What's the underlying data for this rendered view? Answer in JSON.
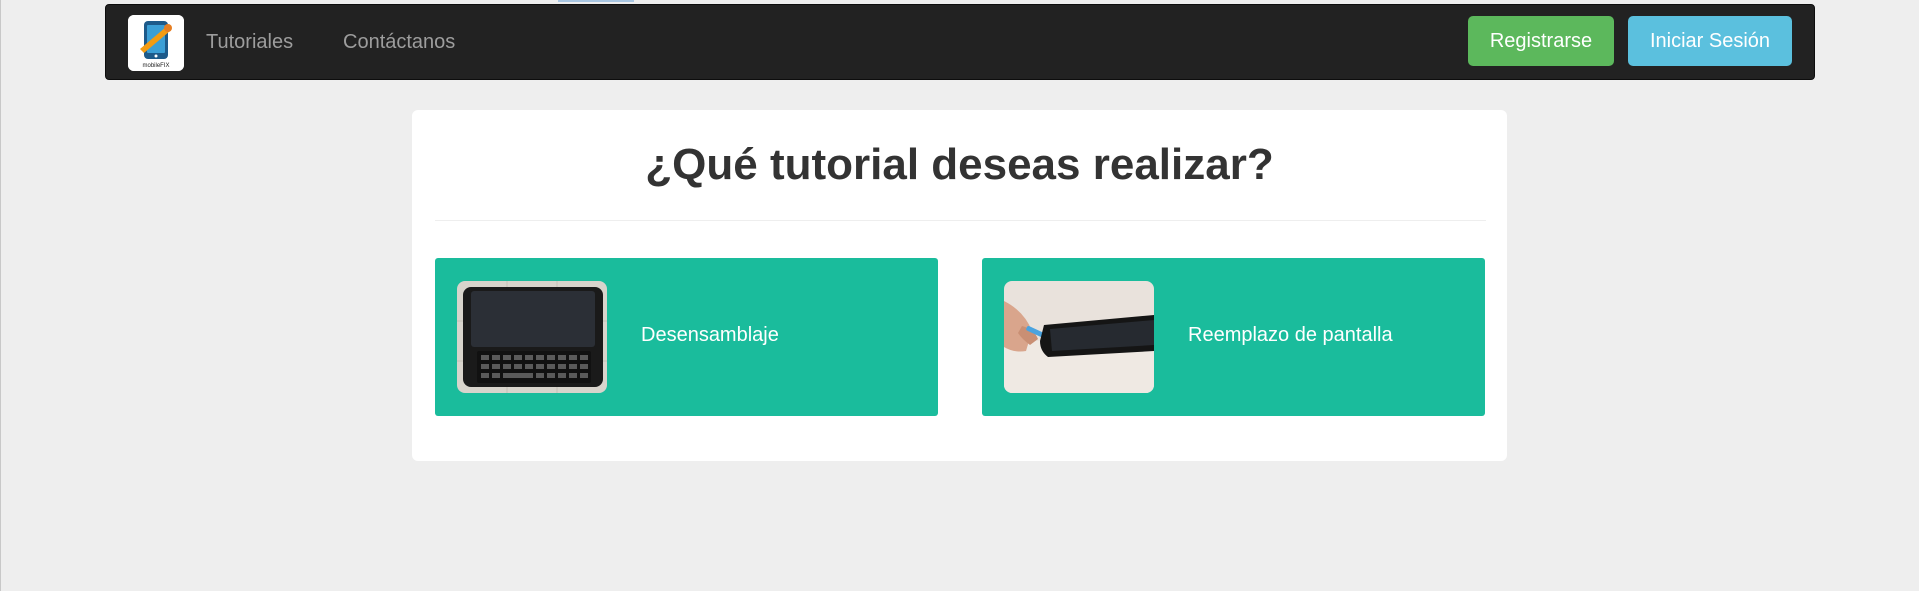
{
  "navbar": {
    "logo_text": "mobileFIX",
    "links": [
      {
        "label": "Tutoriales"
      },
      {
        "label": "Contáctanos"
      }
    ],
    "register_label": "Registrarse",
    "login_label": "Iniciar Sesión"
  },
  "main": {
    "title": "¿Qué tutorial deseas realizar?",
    "tutorials": [
      {
        "label": "Desensamblaje",
        "image": "phone-keyboard-photo"
      },
      {
        "label": "Reemplazo de pantalla",
        "image": "phone-screen-photo"
      }
    ]
  },
  "colors": {
    "navbar_bg": "#222222",
    "register_button": "#5cb85c",
    "login_button": "#5bc0de",
    "card_bg": "#1abc9c",
    "page_bg": "#eeeeee"
  }
}
